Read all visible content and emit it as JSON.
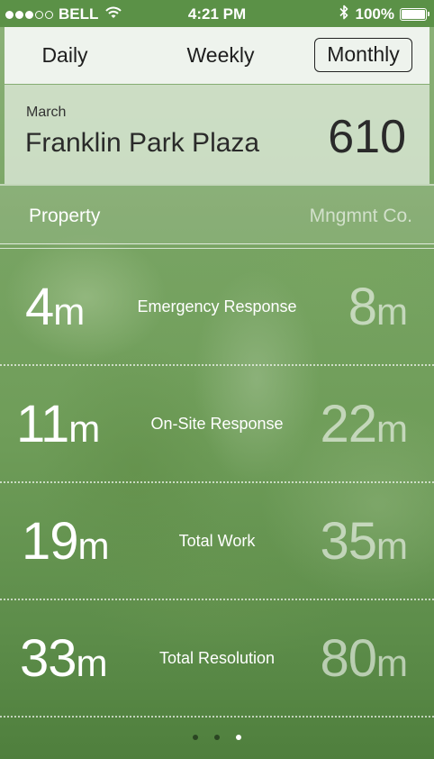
{
  "status_bar": {
    "carrier": "BELL",
    "time": "4:21 PM",
    "battery": "100%",
    "signal_bars_filled": 3,
    "signal_bars_total": 5
  },
  "tabs": [
    {
      "label": "Daily",
      "selected": false
    },
    {
      "label": "Weekly",
      "selected": false
    },
    {
      "label": "Monthly",
      "selected": true
    }
  ],
  "header": {
    "month": "March",
    "property": "Franklin Park Plaza",
    "score": "610"
  },
  "columns": {
    "left": "Property",
    "right": "Mngmnt Co."
  },
  "metrics": [
    {
      "label": "Emergency Response",
      "property_value": "4",
      "mgmt_value": "8",
      "unit": "m"
    },
    {
      "label": "On-Site Response",
      "property_value": "11",
      "mgmt_value": "22",
      "unit": "m"
    },
    {
      "label": "Total Work",
      "property_value": "19",
      "mgmt_value": "35",
      "unit": "m"
    },
    {
      "label": "Total Resolution",
      "property_value": "33",
      "mgmt_value": "80",
      "unit": "m"
    }
  ],
  "pagination": {
    "total_pages": 3,
    "current_page": 3
  },
  "colors": {
    "status_bar": "#5b9147",
    "tab_bar": "#eef3ed",
    "background_green": "#6f9d59"
  }
}
